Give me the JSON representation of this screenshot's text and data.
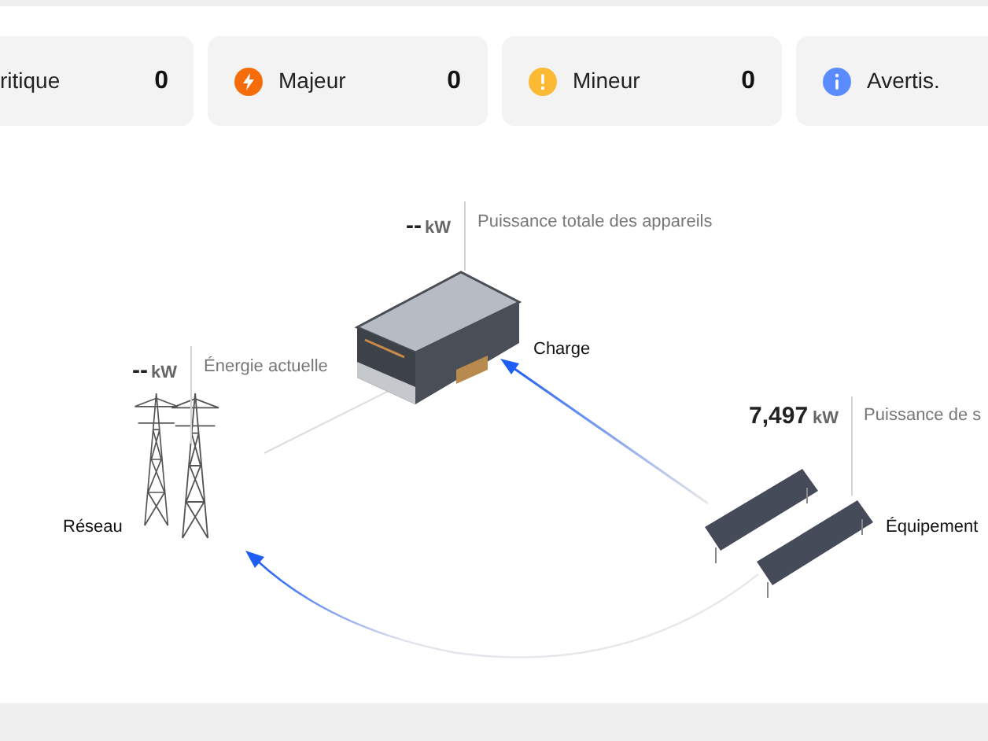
{
  "alarms": [
    {
      "kind": "critical",
      "label": "ritique",
      "count": "0"
    },
    {
      "kind": "major",
      "label": "Majeur",
      "count": "0",
      "color": "#f56c0a"
    },
    {
      "kind": "minor",
      "label": "Mineur",
      "count": "0",
      "color": "#fbb934"
    },
    {
      "kind": "warning",
      "label": "Avertis.",
      "color": "#5b8cff"
    }
  ],
  "diagram": {
    "load": {
      "value": "--",
      "unit": "kW",
      "caption": "Puissance totale des appareils",
      "name": "Charge"
    },
    "grid": {
      "value": "--",
      "unit": "kW",
      "caption": "Énergie actuelle",
      "name": "Réseau"
    },
    "solar": {
      "value": "7,497",
      "unit": "kW",
      "caption": "Puissance de s",
      "name": "Équipement"
    }
  }
}
